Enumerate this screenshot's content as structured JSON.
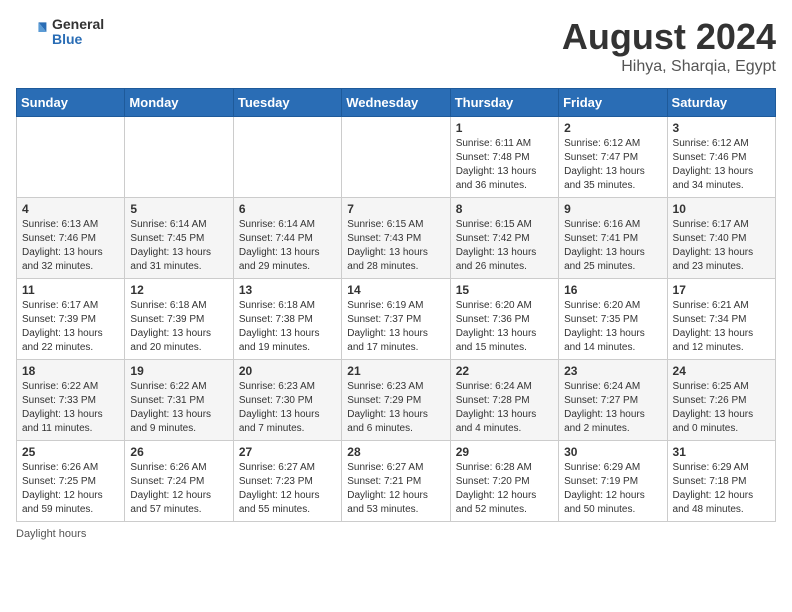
{
  "header": {
    "logo_general": "General",
    "logo_blue": "Blue",
    "main_title": "August 2024",
    "sub_title": "Hihya, Sharqia, Egypt"
  },
  "calendar": {
    "columns": [
      "Sunday",
      "Monday",
      "Tuesday",
      "Wednesday",
      "Thursday",
      "Friday",
      "Saturday"
    ],
    "weeks": [
      [
        {
          "num": "",
          "info": ""
        },
        {
          "num": "",
          "info": ""
        },
        {
          "num": "",
          "info": ""
        },
        {
          "num": "",
          "info": ""
        },
        {
          "num": "1",
          "info": "Sunrise: 6:11 AM\nSunset: 7:48 PM\nDaylight: 13 hours\nand 36 minutes."
        },
        {
          "num": "2",
          "info": "Sunrise: 6:12 AM\nSunset: 7:47 PM\nDaylight: 13 hours\nand 35 minutes."
        },
        {
          "num": "3",
          "info": "Sunrise: 6:12 AM\nSunset: 7:46 PM\nDaylight: 13 hours\nand 34 minutes."
        }
      ],
      [
        {
          "num": "4",
          "info": "Sunrise: 6:13 AM\nSunset: 7:46 PM\nDaylight: 13 hours\nand 32 minutes."
        },
        {
          "num": "5",
          "info": "Sunrise: 6:14 AM\nSunset: 7:45 PM\nDaylight: 13 hours\nand 31 minutes."
        },
        {
          "num": "6",
          "info": "Sunrise: 6:14 AM\nSunset: 7:44 PM\nDaylight: 13 hours\nand 29 minutes."
        },
        {
          "num": "7",
          "info": "Sunrise: 6:15 AM\nSunset: 7:43 PM\nDaylight: 13 hours\nand 28 minutes."
        },
        {
          "num": "8",
          "info": "Sunrise: 6:15 AM\nSunset: 7:42 PM\nDaylight: 13 hours\nand 26 minutes."
        },
        {
          "num": "9",
          "info": "Sunrise: 6:16 AM\nSunset: 7:41 PM\nDaylight: 13 hours\nand 25 minutes."
        },
        {
          "num": "10",
          "info": "Sunrise: 6:17 AM\nSunset: 7:40 PM\nDaylight: 13 hours\nand 23 minutes."
        }
      ],
      [
        {
          "num": "11",
          "info": "Sunrise: 6:17 AM\nSunset: 7:39 PM\nDaylight: 13 hours\nand 22 minutes."
        },
        {
          "num": "12",
          "info": "Sunrise: 6:18 AM\nSunset: 7:39 PM\nDaylight: 13 hours\nand 20 minutes."
        },
        {
          "num": "13",
          "info": "Sunrise: 6:18 AM\nSunset: 7:38 PM\nDaylight: 13 hours\nand 19 minutes."
        },
        {
          "num": "14",
          "info": "Sunrise: 6:19 AM\nSunset: 7:37 PM\nDaylight: 13 hours\nand 17 minutes."
        },
        {
          "num": "15",
          "info": "Sunrise: 6:20 AM\nSunset: 7:36 PM\nDaylight: 13 hours\nand 15 minutes."
        },
        {
          "num": "16",
          "info": "Sunrise: 6:20 AM\nSunset: 7:35 PM\nDaylight: 13 hours\nand 14 minutes."
        },
        {
          "num": "17",
          "info": "Sunrise: 6:21 AM\nSunset: 7:34 PM\nDaylight: 13 hours\nand 12 minutes."
        }
      ],
      [
        {
          "num": "18",
          "info": "Sunrise: 6:22 AM\nSunset: 7:33 PM\nDaylight: 13 hours\nand 11 minutes."
        },
        {
          "num": "19",
          "info": "Sunrise: 6:22 AM\nSunset: 7:31 PM\nDaylight: 13 hours\nand 9 minutes."
        },
        {
          "num": "20",
          "info": "Sunrise: 6:23 AM\nSunset: 7:30 PM\nDaylight: 13 hours\nand 7 minutes."
        },
        {
          "num": "21",
          "info": "Sunrise: 6:23 AM\nSunset: 7:29 PM\nDaylight: 13 hours\nand 6 minutes."
        },
        {
          "num": "22",
          "info": "Sunrise: 6:24 AM\nSunset: 7:28 PM\nDaylight: 13 hours\nand 4 minutes."
        },
        {
          "num": "23",
          "info": "Sunrise: 6:24 AM\nSunset: 7:27 PM\nDaylight: 13 hours\nand 2 minutes."
        },
        {
          "num": "24",
          "info": "Sunrise: 6:25 AM\nSunset: 7:26 PM\nDaylight: 13 hours\nand 0 minutes."
        }
      ],
      [
        {
          "num": "25",
          "info": "Sunrise: 6:26 AM\nSunset: 7:25 PM\nDaylight: 12 hours\nand 59 minutes."
        },
        {
          "num": "26",
          "info": "Sunrise: 6:26 AM\nSunset: 7:24 PM\nDaylight: 12 hours\nand 57 minutes."
        },
        {
          "num": "27",
          "info": "Sunrise: 6:27 AM\nSunset: 7:23 PM\nDaylight: 12 hours\nand 55 minutes."
        },
        {
          "num": "28",
          "info": "Sunrise: 6:27 AM\nSunset: 7:21 PM\nDaylight: 12 hours\nand 53 minutes."
        },
        {
          "num": "29",
          "info": "Sunrise: 6:28 AM\nSunset: 7:20 PM\nDaylight: 12 hours\nand 52 minutes."
        },
        {
          "num": "30",
          "info": "Sunrise: 6:29 AM\nSunset: 7:19 PM\nDaylight: 12 hours\nand 50 minutes."
        },
        {
          "num": "31",
          "info": "Sunrise: 6:29 AM\nSunset: 7:18 PM\nDaylight: 12 hours\nand 48 minutes."
        }
      ]
    ]
  },
  "footer": {
    "daylight_label": "Daylight hours"
  }
}
